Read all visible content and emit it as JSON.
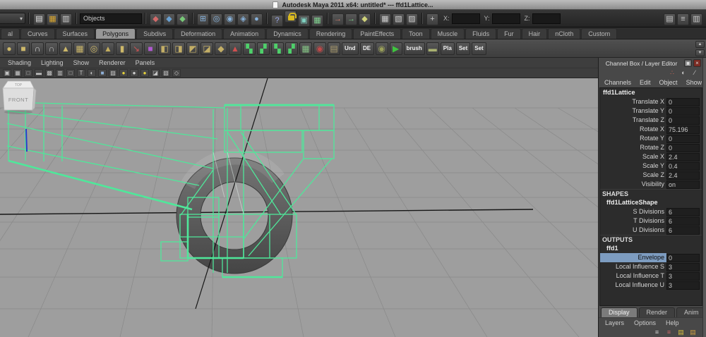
{
  "title_bar": {
    "title": "Autodesk Maya 2011 x64: untitled*   ---   ffd1Lattice..."
  },
  "status_line": {
    "objects_field": "Objects",
    "coord_labels": {
      "x": "X:",
      "y": "Y:",
      "z": "Z:"
    },
    "file_icons": [
      {
        "name": "new-scene-icon",
        "glyph": "▤",
        "color": "#e8e8e8"
      },
      {
        "name": "open-scene-icon",
        "glyph": "▦",
        "color": "#d9a62e"
      },
      {
        "name": "save-scene-icon",
        "glyph": "▥",
        "color": "#d2d2d2"
      }
    ],
    "selection_icons": [
      {
        "name": "select-hierarchy-icon",
        "glyph": "◆",
        "color": "#d26a6a"
      },
      {
        "name": "select-object-icon",
        "glyph": "◆",
        "color": "#6aa1d2"
      },
      {
        "name": "select-component-icon",
        "glyph": "◆",
        "color": "#77c877"
      }
    ],
    "snap_icons": [
      {
        "name": "snap-grid-icon",
        "glyph": "⊞",
        "color": "#86b2dc"
      },
      {
        "name": "snap-curve-icon",
        "glyph": "◎",
        "color": "#86b2dc"
      },
      {
        "name": "snap-point-icon",
        "glyph": "◉",
        "color": "#86b2dc"
      },
      {
        "name": "snap-plane-icon",
        "glyph": "◈",
        "color": "#86b2dc"
      },
      {
        "name": "make-live-icon",
        "glyph": "●",
        "color": "#86b2dc"
      }
    ],
    "history_icons": [
      {
        "name": "quick-help-icon",
        "glyph": "?",
        "color": "#9aa6e8"
      },
      {
        "name": "lock-icon",
        "cls": "lock"
      },
      {
        "name": "highlight-selection-icon",
        "glyph": "▣",
        "color": "#7fd0c0"
      },
      {
        "name": "render-flag-icon",
        "glyph": "▦",
        "color": "#7fd08f"
      }
    ],
    "io_icons": [
      {
        "name": "input-connections-icon",
        "glyph": "→",
        "color": "#d27a6a"
      },
      {
        "name": "output-connections-icon",
        "glyph": "→",
        "color": "#7ad28a"
      },
      {
        "name": "construction-history-icon",
        "glyph": "◆",
        "color": "#cfd27a"
      }
    ],
    "render_icons": [
      {
        "name": "render-view-icon",
        "glyph": "▦",
        "color": "#cfcfcf"
      },
      {
        "name": "ipr-render-icon",
        "glyph": "▧",
        "color": "#cfcfcf"
      },
      {
        "name": "render-settings-icon",
        "glyph": "▨",
        "color": "#cfcfcf"
      }
    ],
    "coord_icons": [
      {
        "name": "select-by-name-icon",
        "glyph": "+",
        "color": "#c8c8c8"
      }
    ],
    "right_icons": [
      {
        "name": "attribute-editor-toggle-icon",
        "glyph": "▤",
        "color": "#c8c8c8"
      },
      {
        "name": "tool-settings-toggle-icon",
        "glyph": "≡",
        "color": "#c8c8c8"
      },
      {
        "name": "channel-box-toggle-icon",
        "glyph": "▥",
        "color": "#c8c8c8"
      }
    ]
  },
  "shelf": {
    "tabs": [
      {
        "label": "al",
        "active": false
      },
      {
        "label": "Curves",
        "active": false
      },
      {
        "label": "Surfaces",
        "active": false
      },
      {
        "label": "Polygons",
        "active": true
      },
      {
        "label": "Subdivs",
        "active": false
      },
      {
        "label": "Deformation",
        "active": false
      },
      {
        "label": "Animation",
        "active": false
      },
      {
        "label": "Dynamics",
        "active": false
      },
      {
        "label": "Rendering",
        "active": false
      },
      {
        "label": "PaintEffects",
        "active": false
      },
      {
        "label": "Toon",
        "active": false
      },
      {
        "label": "Muscle",
        "active": false
      },
      {
        "label": "Fluids",
        "active": false
      },
      {
        "label": "Fur",
        "active": false
      },
      {
        "label": "Hair",
        "active": false
      },
      {
        "label": "nCloth",
        "active": false
      },
      {
        "label": "Custom",
        "active": false
      }
    ],
    "icons": [
      {
        "name": "poly-sphere-icon",
        "glyph": "●",
        "color": "#cdb86a"
      },
      {
        "name": "poly-cube-icon",
        "glyph": "■",
        "color": "#cdb86a"
      },
      {
        "name": "smooth-mesh-icon",
        "glyph": "∩",
        "color": "#d8d8d8"
      },
      {
        "name": "smooth-mesh-preview-icon",
        "glyph": "∩",
        "color": "#bfbfbf"
      },
      {
        "name": "poly-cone-icon",
        "glyph": "▲",
        "color": "#cdb86a"
      },
      {
        "name": "poly-plane-icon",
        "glyph": "▦",
        "color": "#cdb86a"
      },
      {
        "name": "poly-torus-icon",
        "glyph": "◎",
        "color": "#cdb86a"
      },
      {
        "name": "poly-pyramid-icon",
        "glyph": "▲",
        "color": "#c2ad5e"
      },
      {
        "name": "poly-pipe-icon",
        "glyph": "▮",
        "color": "#cdb86a"
      },
      {
        "name": "curve-arrow-icon",
        "glyph": "↘",
        "color": "#cc5555"
      },
      {
        "name": "subdiv-cube-icon",
        "glyph": "■",
        "color": "#b05ad0"
      },
      {
        "name": "combine-icon",
        "glyph": "◧",
        "color": "#c3ae66"
      },
      {
        "name": "extract-icon",
        "glyph": "◨",
        "color": "#c3ae66"
      },
      {
        "name": "boolean-icon",
        "glyph": "◩",
        "color": "#c3ae66"
      },
      {
        "name": "split-poly-icon",
        "glyph": "◪",
        "color": "#c3ae66"
      },
      {
        "name": "bevel-icon",
        "glyph": "◆",
        "color": "#c3ae66"
      },
      {
        "name": "reduce-icon",
        "glyph": "▲",
        "color": "#d05050"
      },
      {
        "name": "checker-map-icon",
        "glyph": "▚",
        "color": "#4ed06a"
      },
      {
        "name": "checker-map2-icon",
        "glyph": "▞",
        "color": "#4ed06a"
      },
      {
        "name": "checker-map3-icon",
        "glyph": "▚",
        "color": "#4ed06a"
      },
      {
        "name": "checker-map4-icon",
        "glyph": "▞",
        "color": "#4ed06a"
      },
      {
        "name": "uv-grid-icon",
        "glyph": "▦",
        "color": "#86c586"
      },
      {
        "name": "stop-light-icon",
        "glyph": "◉",
        "color": "#c04848"
      },
      {
        "name": "map-icon",
        "glyph": "▤",
        "color": "#b0a070"
      },
      {
        "name": "undo-badge",
        "label": "Und"
      },
      {
        "name": "de-badge",
        "label": "DE"
      },
      {
        "name": "grenade-icon",
        "glyph": "◉",
        "color": "#9aa05a"
      },
      {
        "name": "play-icon",
        "glyph": "▶",
        "color": "#3fc43f"
      },
      {
        "name": "brush-badge",
        "label": "brush"
      },
      {
        "name": "money-icon",
        "glyph": "▬",
        "color": "#a8b070"
      },
      {
        "name": "pla-badge",
        "label": "Pla"
      },
      {
        "name": "set-badge",
        "label": "Set"
      },
      {
        "name": "set2-badge",
        "label": "Set"
      }
    ],
    "spinner_up": "▲",
    "spinner_down": "▼"
  },
  "viewport": {
    "menus": [
      "Shading",
      "Lighting",
      "Show",
      "Renderer",
      "Panels"
    ],
    "toolbar_icons": [
      {
        "name": "select-camera-icon",
        "glyph": "▣",
        "color": "#c4c4c4"
      },
      {
        "name": "grid-toggle-icon",
        "glyph": "▦",
        "color": "#c4c4c4"
      },
      {
        "name": "film-gate-icon",
        "glyph": "□",
        "color": "#c4c4c4"
      },
      {
        "name": "resolution-gate-icon",
        "glyph": "▬",
        "color": "#c4c4c4"
      },
      {
        "name": "gate-mask-icon",
        "glyph": "▩",
        "color": "#c4c4c4"
      },
      {
        "name": "field-chart-icon",
        "glyph": "▥",
        "color": "#c4c4c4"
      },
      {
        "name": "safe-action-icon",
        "glyph": "□",
        "color": "#c4c4c4"
      },
      {
        "name": "safe-title-icon",
        "glyph": "T",
        "color": "#c4c4c4"
      },
      {
        "name": "wireframe-icon",
        "glyph": "◐",
        "color": "#c4c4c4"
      },
      {
        "name": "shaded-icon",
        "glyph": "■",
        "color": "#8fb0d8"
      },
      {
        "name": "textured-icon",
        "glyph": "▨",
        "color": "#c4c4c4"
      },
      {
        "name": "all-lights-icon",
        "glyph": "●",
        "color": "#e6d23a"
      },
      {
        "name": "no-lights-icon",
        "glyph": "●",
        "color": "#cfcfcf"
      },
      {
        "name": "default-light-icon",
        "glyph": "●",
        "color": "#e6d23a"
      },
      {
        "name": "isolate-select-icon",
        "glyph": "◪",
        "color": "#c4c4c4"
      },
      {
        "name": "xray-icon",
        "glyph": "▧",
        "color": "#c4c4c4"
      },
      {
        "name": "plane-toggle-icon",
        "glyph": "◇",
        "color": "#c4c4c4"
      }
    ],
    "view_cube": {
      "top": "TOP",
      "front": "FRONT"
    },
    "colors": {
      "vp_bg": "#9e9e9e",
      "grid": "#898989",
      "axis": "#161616",
      "lattice": "#4fe79a",
      "sel_edge": "#2a3acc",
      "sel_fill": "#7d9cc0"
    }
  },
  "channel_box": {
    "header": "Channel Box / Layer Editor",
    "window_icons": [
      {
        "name": "float-panel-icon",
        "glyph": "▣",
        "color": "#dddddd"
      },
      {
        "name": "close-panel-icon",
        "glyph": "×",
        "color": "#f0dcdc",
        "cls": "closeglyph"
      }
    ],
    "tool_icons": [
      {
        "name": "show-manipulators-icon",
        "glyph": "∴",
        "color": "#cc6655"
      },
      {
        "name": "speed-state-icon",
        "glyph": "◐",
        "color": "#c9c9c9"
      },
      {
        "name": "hyperbuild-icon",
        "glyph": "∕",
        "color": "#c9c9c9"
      }
    ],
    "menus": [
      "Channels",
      "Edit",
      "Object",
      "Show"
    ],
    "rows": [
      {
        "type": "node",
        "label": "ffd1Lattice"
      },
      {
        "type": "attr",
        "label": "Translate X",
        "value": "0"
      },
      {
        "type": "attr",
        "label": "Translate Y",
        "value": "0"
      },
      {
        "type": "attr",
        "label": "Translate Z",
        "value": "0"
      },
      {
        "type": "attr",
        "label": "Rotate X",
        "value": "75.196"
      },
      {
        "type": "attr",
        "label": "Rotate Y",
        "value": "0"
      },
      {
        "type": "attr",
        "label": "Rotate Z",
        "value": "0"
      },
      {
        "type": "attr",
        "label": "Scale X",
        "value": "2.4"
      },
      {
        "type": "attr",
        "label": "Scale Y",
        "value": "0.4"
      },
      {
        "type": "attr",
        "label": "Scale Z",
        "value": "2.4"
      },
      {
        "type": "attr",
        "label": "Visibility",
        "value": "on"
      },
      {
        "type": "header",
        "label": "SHAPES"
      },
      {
        "type": "node2",
        "label": "ffd1LatticeShape"
      },
      {
        "type": "attr",
        "label": "S Divisions",
        "value": "6"
      },
      {
        "type": "attr",
        "label": "T Divisions",
        "value": "6"
      },
      {
        "type": "attr",
        "label": "U Divisions",
        "value": "6"
      },
      {
        "type": "header",
        "label": "OUTPUTS"
      },
      {
        "type": "node2",
        "label": "ffd1"
      },
      {
        "type": "attr",
        "label": "Envelope",
        "value": "0",
        "selected": true
      },
      {
        "type": "attr",
        "label": "Local Influence S",
        "value": "3"
      },
      {
        "type": "attr",
        "label": "Local Influence T",
        "value": "3"
      },
      {
        "type": "attr",
        "label": "Local Influence U",
        "value": "3"
      }
    ],
    "bottom_tabs": [
      {
        "label": "Display",
        "active": true
      },
      {
        "label": "Render",
        "active": false
      },
      {
        "label": "Anim",
        "active": false
      }
    ],
    "bottom_menus": [
      "Layers",
      "Options",
      "Help"
    ],
    "layer_icons": [
      {
        "name": "layer-list-icon",
        "glyph": "≡",
        "color": "#d0d0d0"
      },
      {
        "name": "delete-layer-icon",
        "glyph": "≡",
        "color": "#cc6666"
      },
      {
        "name": "new-empty-layer-icon",
        "glyph": "▤",
        "color": "#d8c040"
      },
      {
        "name": "new-layer-from-selected-icon",
        "glyph": "▤",
        "color": "#d0a040"
      }
    ]
  }
}
